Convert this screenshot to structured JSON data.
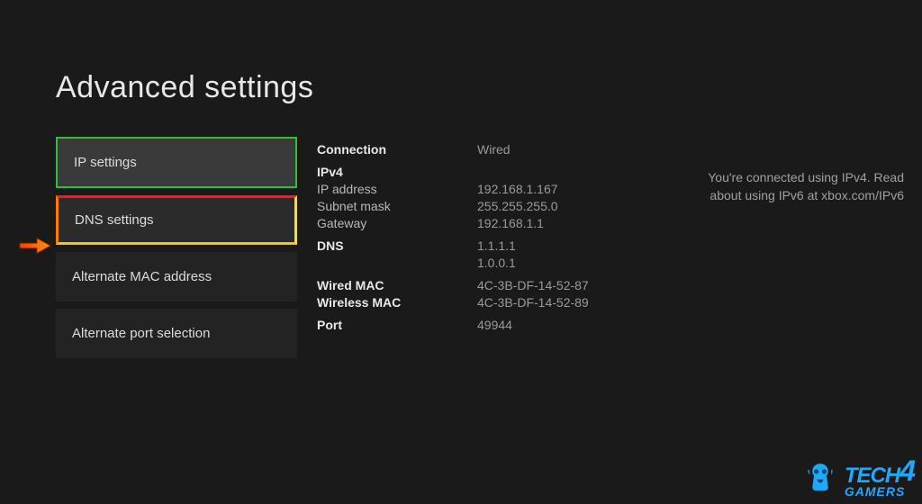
{
  "title": "Advanced settings",
  "menu": {
    "items": [
      {
        "label": "IP settings"
      },
      {
        "label": "DNS settings"
      },
      {
        "label": "Alternate MAC address"
      },
      {
        "label": "Alternate port selection"
      }
    ]
  },
  "details": {
    "connection": {
      "label": "Connection",
      "value": "Wired"
    },
    "ipv4": {
      "heading": "IPv4",
      "ip_label": "IP address",
      "ip_value": "192.168.1.167",
      "subnet_label": "Subnet mask",
      "subnet_value": "255.255.255.0",
      "gateway_label": "Gateway",
      "gateway_value": "192.168.1.1"
    },
    "dns": {
      "label": "DNS",
      "primary": "1.1.1.1",
      "secondary": "1.0.0.1"
    },
    "wired_mac": {
      "label": "Wired MAC",
      "value": "4C-3B-DF-14-52-87"
    },
    "wireless_mac": {
      "label": "Wireless MAC",
      "value": "4C-3B-DF-14-52-89"
    },
    "port": {
      "label": "Port",
      "value": "49944"
    }
  },
  "help": "You're connected using IPv4. Read about using IPv6 at xbox.com/IPv6",
  "brand": {
    "tech": "TECH",
    "four": "4",
    "gamers": "GAMERS"
  }
}
